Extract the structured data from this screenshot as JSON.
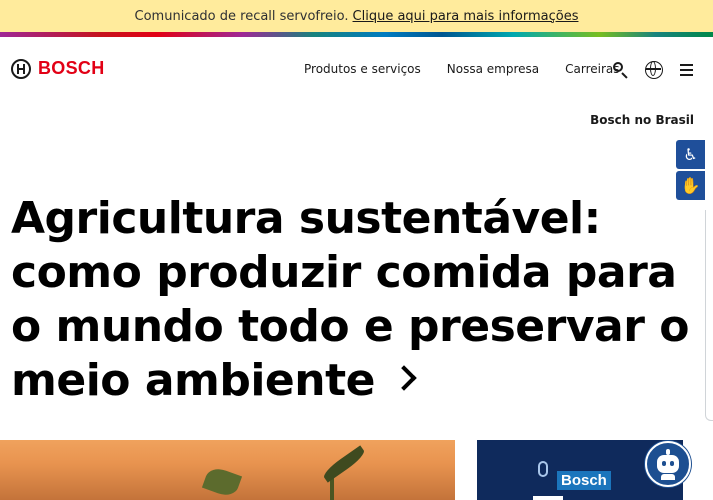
{
  "recall": {
    "text": "Comunicado de recall servofreio.",
    "link": "Clique aqui para mais informações"
  },
  "header": {
    "logo_text": "BOSCH",
    "nav": [
      "Produtos e serviços",
      "Nossa empresa",
      "Carreiras"
    ],
    "icons": [
      "search-icon",
      "globe-icon",
      "menu-icon"
    ]
  },
  "region": "Bosch no Brasil",
  "accessibility": {
    "icons": [
      "accessibility-icon",
      "sign-language-icon"
    ]
  },
  "hero": {
    "headline": "Agricultura sustentável: como produzir comida para o mundo todo e preservar o meio ambiente"
  },
  "podcast": {
    "label": "Bosch"
  },
  "colors": {
    "brand_red": "#e20015",
    "recall_bg": "#ffeb9c",
    "accessibility_blue": "#1f4f9a",
    "chatbot_blue": "#1d4f91"
  }
}
